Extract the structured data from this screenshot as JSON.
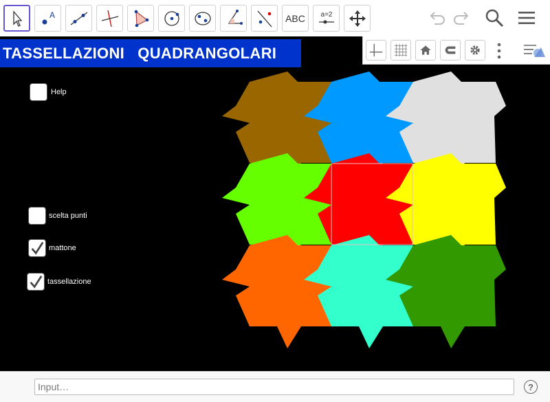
{
  "toolbar": {
    "tools": [
      {
        "name": "move-tool",
        "icon": "arrow-cursor-icon"
      },
      {
        "name": "point-tool",
        "icon": "point-icon"
      },
      {
        "name": "line-tool",
        "icon": "line-icon"
      },
      {
        "name": "perpendicular-tool",
        "icon": "perpendicular-icon"
      },
      {
        "name": "polygon-tool",
        "icon": "polygon-icon"
      },
      {
        "name": "circle-tool",
        "icon": "circle-icon"
      },
      {
        "name": "ellipse-tool",
        "icon": "ellipse-icon"
      },
      {
        "name": "angle-tool",
        "icon": "angle-icon"
      },
      {
        "name": "reflect-tool",
        "icon": "reflect-icon"
      },
      {
        "name": "text-tool",
        "icon": "text-icon",
        "label": "ABC"
      },
      {
        "name": "slider-tool",
        "icon": "slider-icon",
        "label": "a=2"
      },
      {
        "name": "move-graphics-tool",
        "icon": "move-graphics-icon"
      }
    ],
    "right": [
      "undo-icon",
      "redo-icon",
      "search-icon",
      "menu-icon"
    ]
  },
  "canvas": {
    "title": "TASSELLAZIONI   QUADRANGOLARI",
    "checkboxes": [
      {
        "label": "Help",
        "checked": false
      },
      {
        "label": "scelta punti",
        "checked": false
      },
      {
        "label": "mattone",
        "checked": true
      },
      {
        "label": "tassellazione",
        "checked": true
      }
    ],
    "tile_colors": [
      "#996600",
      "#0099ff",
      "#e0e0e0",
      "#66ff00",
      "#ff0000",
      "#ffff00",
      "#ff6600",
      "#33ffcc",
      "#339900"
    ],
    "background": "#000000"
  },
  "graphics_bar": {
    "buttons": [
      "axes-icon",
      "grid-icon",
      "home-icon",
      "magnet-icon",
      "gear-icon",
      "more-icon",
      "style-bar-icon"
    ]
  },
  "input_bar": {
    "placeholder": "Input…",
    "help": "?"
  }
}
